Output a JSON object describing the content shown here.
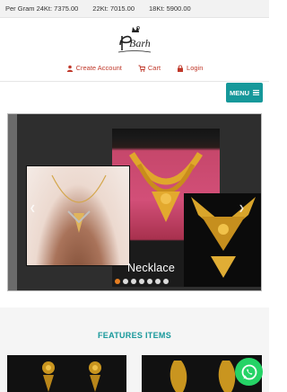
{
  "rates": [
    {
      "text": "Per Gram 24Kt: 7375.00"
    },
    {
      "text": "22Kt: 7015.00"
    },
    {
      "text": "18Kt: 5900.00"
    }
  ],
  "brand": {
    "logo_text": "Barh"
  },
  "top_links": [
    {
      "label": "Create Account",
      "icon": "user-icon"
    },
    {
      "label": "Cart",
      "icon": "cart-icon"
    },
    {
      "label": "Login",
      "icon": "lock-icon"
    }
  ],
  "menu": {
    "label": "MENU",
    "icon": "hamburger-icon"
  },
  "slider": {
    "caption": "Necklace",
    "slide_count": 7,
    "active_index": 0,
    "prev_icon": "chevron-left-icon",
    "next_icon": "chevron-right-icon"
  },
  "features": {
    "title": "FEATURES ITEMS"
  },
  "colors": {
    "accent": "#16989a",
    "link": "#c0392b",
    "active_dot": "#e67e22",
    "whatsapp": "#25d366"
  },
  "floating": {
    "icon": "whatsapp-icon"
  }
}
